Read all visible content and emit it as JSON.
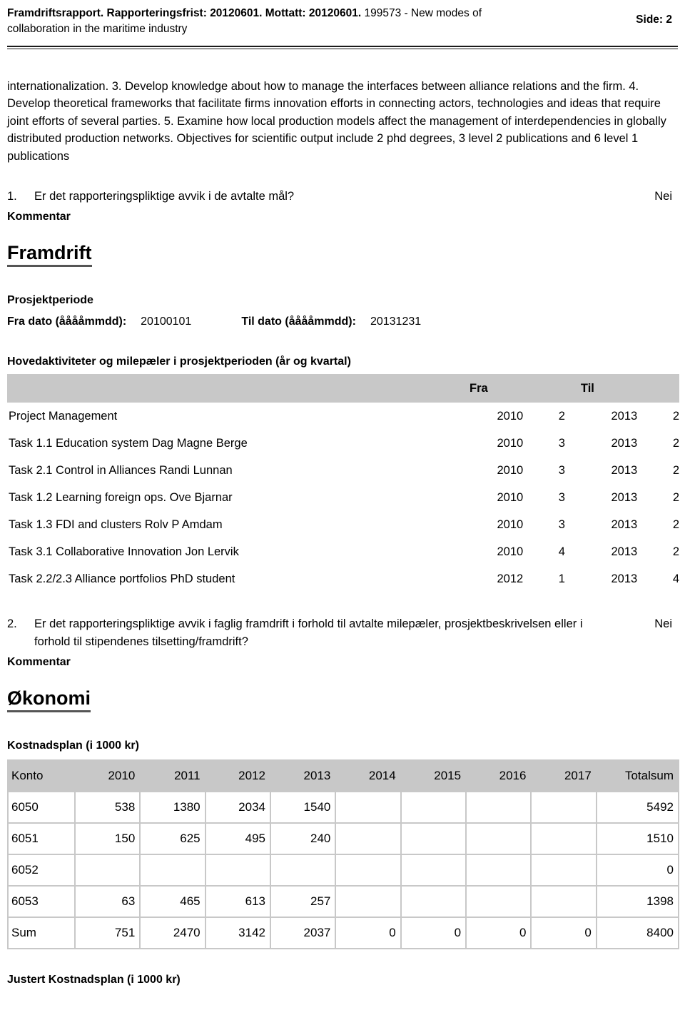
{
  "header": {
    "bold_part": "Framdriftsrapport. Rapporteringsfrist: 20120601. Mottatt: 20120601.",
    "light_part": " 199573 - New modes of collaboration in the maritime industry",
    "page_label": "Side: 2"
  },
  "body": {
    "paragraph": "internationalization. 3. Develop knowledge about how to manage the interfaces between alliance relations and the firm. 4. Develop theoretical frameworks that facilitate firms innovation efforts in connecting actors, technologies and ideas that require joint efforts of several parties. 5. Examine how local production models affect the management of interdependencies in globally distributed production networks. Objectives for scientific output include 2 phd degrees, 3 level 2 publications and 6 level 1 publications"
  },
  "question1": {
    "number": "1.",
    "text": "Er det rapporteringspliktige avvik i de avtalte mål?",
    "answer": "Nei",
    "kommentar_label": "Kommentar"
  },
  "section_framdrift": {
    "title": "Framdrift",
    "prosjektperiode_label": "Prosjektperiode",
    "fra_dato_label": "Fra dato (ååååmmdd):",
    "fra_dato_value": "20100101",
    "til_dato_label": "Til dato (ååååmmdd):",
    "til_dato_value": "20131231"
  },
  "milestones": {
    "title": "Hovedaktiviteter og milepæler i prosjektperioden (år og kvartal)",
    "columns": [
      "",
      "Fra",
      "",
      "Til",
      ""
    ],
    "header_fra": "Fra",
    "header_til": "Til",
    "rows": [
      {
        "task": "Project Management",
        "fra_year": "2010",
        "fra_q": "2",
        "til_year": "2013",
        "til_q": "2"
      },
      {
        "task": "Task 1.1 Education system Dag Magne Berge",
        "fra_year": "2010",
        "fra_q": "3",
        "til_year": "2013",
        "til_q": "2"
      },
      {
        "task": "Task 2.1 Control in Alliances Randi Lunnan",
        "fra_year": "2010",
        "fra_q": "3",
        "til_year": "2013",
        "til_q": "2"
      },
      {
        "task": "Task 1.2 Learning foreign ops. Ove Bjarnar",
        "fra_year": "2010",
        "fra_q": "3",
        "til_year": "2013",
        "til_q": "2"
      },
      {
        "task": "Task 1.3 FDI and clusters Rolv P Amdam",
        "fra_year": "2010",
        "fra_q": "3",
        "til_year": "2013",
        "til_q": "2"
      },
      {
        "task": "Task 3.1 Collaborative Innovation Jon Lervik",
        "fra_year": "2010",
        "fra_q": "4",
        "til_year": "2013",
        "til_q": "2"
      },
      {
        "task": "Task 2.2/2.3 Alliance portfolios PhD student",
        "fra_year": "2012",
        "fra_q": "1",
        "til_year": "2013",
        "til_q": "4"
      }
    ]
  },
  "question2": {
    "number": "2.",
    "text": "Er det rapporteringspliktige avvik i faglig framdrift i forhold til avtalte milepæler, prosjektbeskrivelsen eller i forhold til stipendenes tilsetting/framdrift?",
    "answer": "Nei",
    "kommentar_label": "Kommentar"
  },
  "section_okonomi": {
    "title": "Økonomi",
    "kostnadsplan_label": "Kostnadsplan (i 1000 kr)"
  },
  "cost_table": {
    "columns": [
      "Konto",
      "2010",
      "2011",
      "2012",
      "2013",
      "2014",
      "2015",
      "2016",
      "2017",
      "Totalsum"
    ],
    "rows": [
      {
        "konto": "6050",
        "values": [
          "538",
          "1380",
          "2034",
          "1540",
          "",
          "",
          "",
          ""
        ],
        "total": "5492"
      },
      {
        "konto": "6051",
        "values": [
          "150",
          "625",
          "495",
          "240",
          "",
          "",
          "",
          ""
        ],
        "total": "1510"
      },
      {
        "konto": "6052",
        "values": [
          "",
          "",
          "",
          "",
          "",
          "",
          "",
          ""
        ],
        "total": "0"
      },
      {
        "konto": "6053",
        "values": [
          "63",
          "465",
          "613",
          "257",
          "",
          "",
          "",
          ""
        ],
        "total": "1398"
      },
      {
        "konto": "Sum",
        "values": [
          "751",
          "2470",
          "3142",
          "2037",
          "0",
          "0",
          "0",
          "0"
        ],
        "total": "8400"
      }
    ]
  },
  "footer": {
    "justert_label": "Justert Kostnadsplan (i 1000 kr)"
  },
  "colors": {
    "header_band": "#c8c8c8",
    "rule": "#1a1a1a",
    "underline": "#555555"
  }
}
